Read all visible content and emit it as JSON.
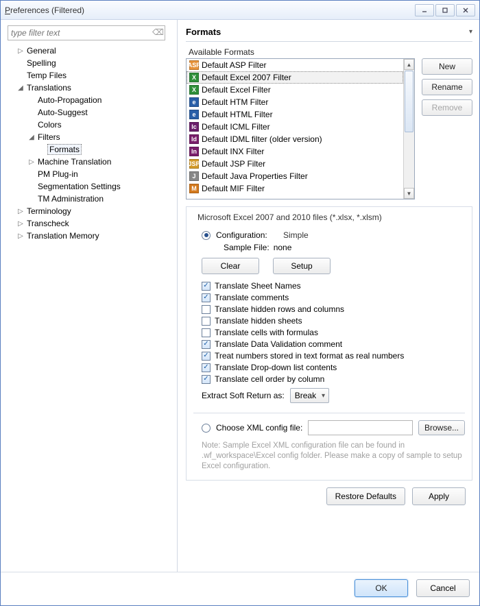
{
  "window": {
    "title_prefix": "P",
    "title_rest": "references (Filtered)"
  },
  "filter": {
    "placeholder": "type filter text"
  },
  "tree": [
    {
      "label": "General",
      "level": 1,
      "twisty": "▷"
    },
    {
      "label": "Spelling",
      "level": 1,
      "twisty": ""
    },
    {
      "label": "Temp Files",
      "level": 1,
      "twisty": ""
    },
    {
      "label": "Translations",
      "level": 1,
      "twisty": "◢"
    },
    {
      "label": "Auto-Propagation",
      "level": 2,
      "twisty": ""
    },
    {
      "label": "Auto-Suggest",
      "level": 2,
      "twisty": ""
    },
    {
      "label": "Colors",
      "level": 2,
      "twisty": ""
    },
    {
      "label": "Filters",
      "level": 2,
      "twisty": "◢"
    },
    {
      "label": "Formats",
      "level": 3,
      "twisty": "",
      "selected": true
    },
    {
      "label": "Machine Translation",
      "level": 2,
      "twisty": "▷"
    },
    {
      "label": "PM Plug-in",
      "level": 2,
      "twisty": ""
    },
    {
      "label": "Segmentation Settings",
      "level": 2,
      "twisty": ""
    },
    {
      "label": "TM Administration",
      "level": 2,
      "twisty": ""
    },
    {
      "label": "Terminology",
      "level": 1,
      "twisty": "▷"
    },
    {
      "label": "Transcheck",
      "level": 1,
      "twisty": "▷"
    },
    {
      "label": "Translation Memory",
      "level": 1,
      "twisty": "▷"
    }
  ],
  "section": {
    "title": "Formats",
    "available_label": "Available Formats"
  },
  "formats": [
    {
      "label": "Default ASP Filter",
      "iconColor": "#e69138",
      "iconText": "ASP"
    },
    {
      "label": "Default Excel 2007 Filter",
      "iconColor": "#2f8f3a",
      "iconText": "X",
      "selected": true
    },
    {
      "label": "Default Excel Filter",
      "iconColor": "#2f8f3a",
      "iconText": "X"
    },
    {
      "label": "Default HTM Filter",
      "iconColor": "#2a5fa8",
      "iconText": "e"
    },
    {
      "label": "Default HTML Filter",
      "iconColor": "#2a5fa8",
      "iconText": "e"
    },
    {
      "label": "Default ICML Filter",
      "iconColor": "#6b1e6b",
      "iconText": "Ic"
    },
    {
      "label": "Default IDML filter (older version)",
      "iconColor": "#7a1e6b",
      "iconText": "Id"
    },
    {
      "label": "Default INX Filter",
      "iconColor": "#7a1e6b",
      "iconText": "In"
    },
    {
      "label": "Default JSP Filter",
      "iconColor": "#d39a2a",
      "iconText": "JSP"
    },
    {
      "label": "Default Java Properties Filter",
      "iconColor": "#888888",
      "iconText": "J"
    },
    {
      "label": "Default MIF Filter",
      "iconColor": "#d47a1e",
      "iconText": "M"
    }
  ],
  "buttons": {
    "new": "New",
    "rename": "Rename",
    "remove": "Remove"
  },
  "details": {
    "title": "Microsoft Excel 2007 and 2010 files (*.xlsx, *.xlsm)",
    "config_label": "Configuration:",
    "config_value": "Simple",
    "sample_label": "Sample File:",
    "sample_value": "none",
    "clear": "Clear",
    "setup": "Setup",
    "checks": [
      {
        "label": "Translate Sheet Names",
        "checked": true
      },
      {
        "label": "Translate comments",
        "checked": true
      },
      {
        "label": "Translate hidden rows and columns",
        "checked": false
      },
      {
        "label": "Translate hidden sheets",
        "checked": false
      },
      {
        "label": "Translate cells with formulas",
        "checked": false
      },
      {
        "label": "Translate Data Validation comment",
        "checked": true
      },
      {
        "label": "Treat numbers stored in text format as real numbers",
        "checked": true
      },
      {
        "label": "Translate Drop-down list contents",
        "checked": true
      },
      {
        "label": "Translate cell order by column",
        "checked": true
      }
    ],
    "extract_label": "Extract Soft Return as:",
    "extract_value": "Break",
    "choose_label": "Choose XML config file:",
    "browse": "Browse...",
    "note": "Note: Sample Excel XML configuration file can be found in .wf_workspace\\Excel config folder. Please make a copy of sample to setup Excel configuration."
  },
  "footer": {
    "restore": "Restore Defaults",
    "apply": "Apply",
    "ok": "OK",
    "cancel": "Cancel"
  }
}
